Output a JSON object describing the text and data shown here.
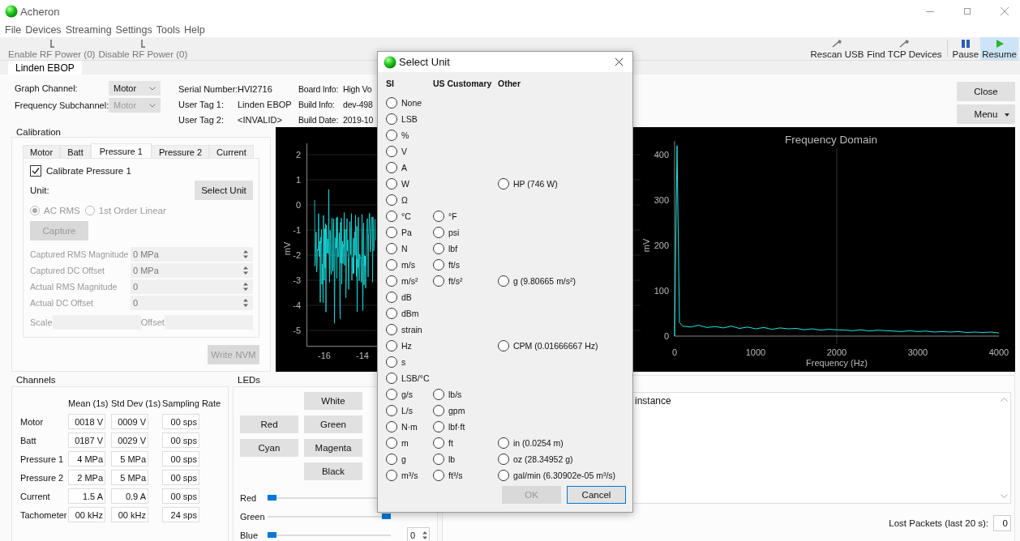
{
  "window": {
    "title": "Acheron"
  },
  "menu": [
    "File",
    "Devices",
    "Streaming",
    "Settings",
    "Tools",
    "Help"
  ],
  "toolbar_left": [
    {
      "label": "Enable RF Power (0)",
      "disabled": true
    },
    {
      "label": "Disable RF Power (0)",
      "disabled": true
    }
  ],
  "toolbar_right": [
    {
      "label": "Rescan USB",
      "kind": "usb",
      "selected": false
    },
    {
      "label": "Find TCP Devices",
      "kind": "usb",
      "selected": false
    },
    {
      "label": "Pause",
      "kind": "pause",
      "selected": false
    },
    {
      "label": "Resume",
      "kind": "play",
      "selected": true
    }
  ],
  "device_tabs": [
    {
      "label": "Linden EBOP",
      "selected": true
    }
  ],
  "graph_channel": {
    "label": "Graph Channel:",
    "value": "Motor",
    "disabled": false
  },
  "frequency_subchannel": {
    "label": "Frequency Subchannel:",
    "value": "Motor",
    "disabled": true
  },
  "device_info": [
    {
      "label": "Serial Number:",
      "value": "HVI2716"
    },
    {
      "label": "User Tag 1:",
      "value": "Linden EBOP"
    },
    {
      "label": "User Tag 2:",
      "value": "<INVALID>"
    }
  ],
  "board_info": [
    {
      "label": "Board Info:",
      "value": "High Vo"
    },
    {
      "label": "Build Info:",
      "value": "dev-498"
    },
    {
      "label": "Build Date:",
      "value": "2019-10"
    }
  ],
  "side_buttons": [
    {
      "label": "Close",
      "kind": "plain"
    },
    {
      "label": "Menu",
      "kind": "dropdown"
    }
  ],
  "calibration": {
    "title": "Calibration",
    "tabs": [
      {
        "label": "Motor",
        "selected": false
      },
      {
        "label": "Batt",
        "selected": false
      },
      {
        "label": "Pressure 1",
        "selected": true
      },
      {
        "label": "Pressure 2",
        "selected": false
      },
      {
        "label": "Current",
        "selected": false
      }
    ],
    "checkbox": {
      "label": "Calibrate Pressure 1",
      "checked": true
    },
    "unit_label": "Unit:",
    "select_unit_button": "Select Unit",
    "modes": [
      {
        "label": "AC RMS",
        "selected": true,
        "disabled": true
      },
      {
        "label": "1st Order Linear",
        "selected": false,
        "disabled": true
      }
    ],
    "capture_button": {
      "label": "Capture",
      "disabled": true
    },
    "fields": [
      {
        "label": "Captured RMS Magnitude",
        "value": "0 MPa",
        "disabled": true
      },
      {
        "label": "Captured DC Offset",
        "value": "0 MPa",
        "disabled": true
      },
      {
        "label": "Actual RMS Magnitude",
        "value": "0",
        "disabled": true
      },
      {
        "label": "Actual DC Offset",
        "value": "0",
        "disabled": true
      }
    ],
    "scale_label": "Scale",
    "offset_label": "Offset",
    "write_button": {
      "label": "Write NVM",
      "disabled": true
    }
  },
  "time_plot": {
    "ylabel": "mV",
    "yticks": [
      "2",
      "1",
      "0",
      "-1",
      "-2",
      "-3",
      "-4",
      "-5"
    ],
    "xticks": [
      "-16",
      "-14"
    ]
  },
  "frequency_plot": {
    "chart_data": {
      "type": "line",
      "title": "Frequency Domain",
      "xlabel": "Frequency (Hz)",
      "ylabel": "mV",
      "x": [
        0,
        30,
        60,
        100,
        200,
        300,
        400,
        500,
        600,
        700,
        800,
        900,
        1000,
        1100,
        1200,
        1300,
        1400,
        1500,
        1600,
        1700,
        1800,
        1900,
        2000,
        2100,
        2200,
        2300,
        2400,
        2500,
        2600,
        2700,
        2800,
        2900,
        3000,
        3100,
        3200,
        3300,
        3400,
        3500,
        3600,
        3700,
        3800,
        3900,
        4000
      ],
      "series": [
        {
          "color": "#19e6e6",
          "values": [
            0,
            420,
            30,
            22,
            20,
            24,
            19,
            21,
            18,
            22,
            17,
            20,
            16,
            19,
            15,
            18,
            16,
            17,
            14,
            16,
            13,
            15,
            14,
            13,
            12,
            14,
            11,
            13,
            12,
            11,
            10,
            12,
            10,
            11,
            9,
            10,
            9,
            10,
            8,
            9,
            8,
            9,
            7
          ]
        }
      ],
      "xlim": [
        0,
        4000
      ],
      "ylim": [
        0,
        430
      ],
      "xticks": [
        0,
        1000,
        2000,
        3000,
        4000
      ],
      "yticks": [
        0,
        100,
        200,
        300,
        400
      ]
    }
  },
  "channels": {
    "title": "Channels",
    "columns": [
      "Mean (1s)",
      "Std Dev (1s)",
      "Sampling Rate"
    ],
    "rows": [
      {
        "name": "Motor",
        "cells": [
          "0018 V",
          "0009 V",
          "00 sps"
        ]
      },
      {
        "name": "Batt",
        "cells": [
          "0187 V",
          "0029 V",
          "00 sps"
        ]
      },
      {
        "name": "Pressure 1",
        "cells": [
          "4 MPa",
          "5 MPa",
          "00 sps"
        ]
      },
      {
        "name": "Pressure 2",
        "cells": [
          "2 MPa",
          "5 MPa",
          "00 sps"
        ]
      },
      {
        "name": "Current",
        "cells": [
          "1.5 A",
          "0.9 A",
          "00 sps"
        ]
      },
      {
        "name": "Tachometer",
        "cells": [
          "00 kHz",
          "00 kHz",
          "24 sps"
        ]
      }
    ]
  },
  "leds": {
    "title": "LEDs",
    "button_rows": [
      [
        null,
        "White"
      ],
      [
        "Red",
        "Green"
      ],
      [
        "Cyan",
        "Magenta"
      ],
      [
        null,
        "Black"
      ]
    ],
    "sliders": [
      {
        "name": "Red",
        "level": 0
      },
      {
        "name": "Green",
        "level": 1
      },
      {
        "name": "Blue",
        "level": 0,
        "value": "0"
      }
    ]
  },
  "log": {
    "text": "instance"
  },
  "lost_packets": {
    "label": "Lost Packets (last 20 s):",
    "value": "0"
  },
  "dialog": {
    "title": "Select Unit",
    "columns": [
      "SI",
      "US Customary",
      "Other"
    ],
    "rows": [
      {
        "si": {
          "label": "None",
          "selected": false
        }
      },
      {
        "si": {
          "label": "LSB",
          "selected": false
        }
      },
      {
        "si": {
          "label": "%",
          "selected": false
        }
      },
      {
        "si": {
          "label": "V",
          "selected": false
        }
      },
      {
        "si": {
          "label": "A",
          "selected": false
        }
      },
      {
        "si": {
          "label": "W",
          "selected": false
        },
        "other": {
          "label": "HP (746 W)",
          "selected": false
        }
      },
      {
        "si": {
          "label": "Ω",
          "selected": false
        }
      },
      {
        "si": {
          "label": "°C",
          "selected": false
        },
        "us": {
          "label": "°F",
          "selected": false
        }
      },
      {
        "si": {
          "label": "Pa",
          "selected": false
        },
        "us": {
          "label": "psi",
          "selected": false
        }
      },
      {
        "si": {
          "label": "N",
          "selected": false
        },
        "us": {
          "label": "lbf",
          "selected": false
        }
      },
      {
        "si": {
          "label": "m/s",
          "selected": false
        },
        "us": {
          "label": "ft/s",
          "selected": false
        }
      },
      {
        "si": {
          "label": "m/s²",
          "selected": false
        },
        "us": {
          "label": "ft/s²",
          "selected": false
        },
        "other": {
          "label": "g (9.80665 m/s²)",
          "selected": false
        }
      },
      {
        "si": {
          "label": "dB",
          "selected": false
        }
      },
      {
        "si": {
          "label": "dBm",
          "selected": false
        }
      },
      {
        "si": {
          "label": "strain",
          "selected": false
        }
      },
      {
        "si": {
          "label": "Hz",
          "selected": false
        },
        "other": {
          "label": "CPM (0.01666667 Hz)",
          "selected": false
        }
      },
      {
        "si": {
          "label": "s",
          "selected": false
        }
      },
      {
        "si": {
          "label": "LSB/°C",
          "selected": false
        }
      },
      {
        "si": {
          "label": "g/s",
          "selected": false
        },
        "us": {
          "label": "lb/s",
          "selected": false
        }
      },
      {
        "si": {
          "label": "L/s",
          "selected": false
        },
        "us": {
          "label": "gpm",
          "selected": false
        }
      },
      {
        "si": {
          "label": "N·m",
          "selected": false
        },
        "us": {
          "label": "lbf·ft",
          "selected": false
        }
      },
      {
        "si": {
          "label": "m",
          "selected": false
        },
        "us": {
          "label": "ft",
          "selected": false
        },
        "other": {
          "label": "in (0.0254 m)",
          "selected": false
        }
      },
      {
        "si": {
          "label": "g",
          "selected": false
        },
        "us": {
          "label": "lb",
          "selected": false
        },
        "other": {
          "label": "oz (28.34952 g)",
          "selected": false
        }
      },
      {
        "si": {
          "label": "m³/s",
          "selected": false
        },
        "us": {
          "label": "ft³/s",
          "selected": false
        },
        "other": {
          "label": "gal/min (6.30902e-05 m³/s)",
          "selected": false
        }
      }
    ],
    "buttons": [
      {
        "label": "OK",
        "disabled": true
      },
      {
        "label": "Cancel",
        "disabled": false
      }
    ]
  }
}
